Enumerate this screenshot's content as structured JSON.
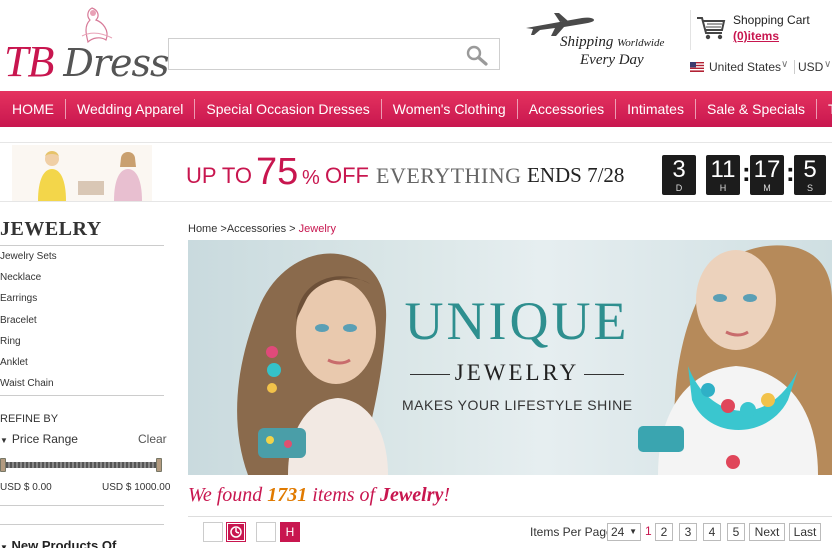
{
  "header": {
    "logo_main": "TB",
    "logo_sub": "Dress",
    "search_placeholder": "",
    "shipping": {
      "line1": "Shipping",
      "line1_small": "Worldwide",
      "line2": "Every Day"
    },
    "cart": {
      "title": "Shopping Cart",
      "items": "(0)items"
    },
    "locale": {
      "country": "United States",
      "currency": "USD"
    }
  },
  "nav": {
    "items": [
      "HOME",
      "Wedding Apparel",
      "Special Occasion Dresses",
      "Women's Clothing",
      "Accessories",
      "Intimates",
      "Sale & Specials",
      "TB Design"
    ]
  },
  "promo": {
    "up_to": "UP TO",
    "percent": "75",
    "percent_sign": "%",
    "off": "OFF",
    "everything": "EVERYTHING",
    "ends": "ENDS 7/28",
    "countdown": [
      {
        "value": "3",
        "unit": "D"
      },
      {
        "value": "11",
        "unit": "H"
      },
      {
        "value": "17",
        "unit": "M"
      },
      {
        "value": "5",
        "unit": "S"
      }
    ]
  },
  "sidebar": {
    "title": "JEWELRY",
    "items": [
      "Jewelry Sets",
      "Necklace",
      "Earrings",
      "Bracelet",
      "Ring",
      "Anklet",
      "Waist Chain"
    ],
    "refine_by": "REFINE BY",
    "price_range_label": "Price Range",
    "clear": "Clear",
    "price_min": "USD $ 0.00",
    "price_max": "USD $ 1000.00",
    "new_products": "New Products Of"
  },
  "breadcrumb": {
    "home": "Home",
    "sep1": " >",
    "parent": "Accessories",
    "sep2": " > ",
    "current": "Jewelry"
  },
  "banner": {
    "headline": "UNIQUE",
    "sub": "JEWELRY",
    "tagline": "MAKES YOUR LIFESTYLE SHINE"
  },
  "results": {
    "prefix": "We found ",
    "count": "1731",
    "middle": " items of ",
    "category": "Jewelry",
    "suffix": "!"
  },
  "toolbar": {
    "view_grid_label": "",
    "view_h_label": "H",
    "items_per_page_label": "Items Per Page",
    "items_per_page_value": "24",
    "current_page": "1",
    "pages": [
      "2",
      "3",
      "4",
      "5"
    ],
    "next": "Next",
    "last": "Last"
  },
  "colors": {
    "brand": "#c8164f",
    "accent_orange": "#e07a00",
    "teal": "#2e8f8f"
  }
}
